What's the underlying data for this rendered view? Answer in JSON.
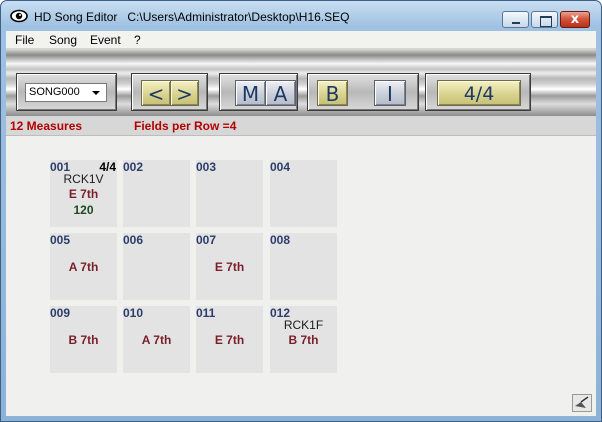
{
  "window": {
    "app_name": "HD Song Editor",
    "file_path": "C:\\Users\\Administrator\\Desktop\\H16.SEQ",
    "close_glyph": "x"
  },
  "menu": [
    "File",
    "Song",
    "Event",
    "?"
  ],
  "toolbar": {
    "song_select": {
      "value": "SONG000"
    },
    "prev_label": "<",
    "next_label": ">",
    "m_label": "M",
    "a_label": "A",
    "b_label": "B",
    "i_label": "I",
    "time_signature_label": "4/4"
  },
  "info": {
    "measures": "12 Measures",
    "fields_per_row": "Fields per Row =4"
  },
  "measures": [
    {
      "num": "001",
      "ts": "4/4",
      "style": "RCK1V",
      "chord": "E 7th",
      "tempo": "120"
    },
    {
      "num": "002",
      "ts": "",
      "style": "",
      "chord": "",
      "tempo": ""
    },
    {
      "num": "003",
      "ts": "",
      "style": "",
      "chord": "",
      "tempo": ""
    },
    {
      "num": "004",
      "ts": "",
      "style": "",
      "chord": "",
      "tempo": ""
    },
    {
      "num": "005",
      "ts": "",
      "style": "",
      "chord": "A 7th",
      "tempo": ""
    },
    {
      "num": "006",
      "ts": "",
      "style": "",
      "chord": "",
      "tempo": ""
    },
    {
      "num": "007",
      "ts": "",
      "style": "",
      "chord": "E 7th",
      "tempo": ""
    },
    {
      "num": "008",
      "ts": "",
      "style": "",
      "chord": "",
      "tempo": ""
    },
    {
      "num": "009",
      "ts": "",
      "style": "",
      "chord": "B 7th",
      "tempo": ""
    },
    {
      "num": "010",
      "ts": "",
      "style": "",
      "chord": "A 7th",
      "tempo": ""
    },
    {
      "num": "011",
      "ts": "",
      "style": "",
      "chord": "E 7th",
      "tempo": ""
    },
    {
      "num": "012",
      "ts": "",
      "style": "RCK1F",
      "chord": "B 7th",
      "tempo": ""
    }
  ],
  "colors": {
    "info_text": "#b30000",
    "measure_number": "#2b3e6b",
    "chord_text": "#7a1f2a",
    "tempo_text": "#1e4a1e"
  },
  "icons": [
    "app-eye-icon",
    "minimize-icon",
    "maximize-icon",
    "close-icon",
    "dropdown-arrow-icon",
    "resize-grip-icon"
  ]
}
